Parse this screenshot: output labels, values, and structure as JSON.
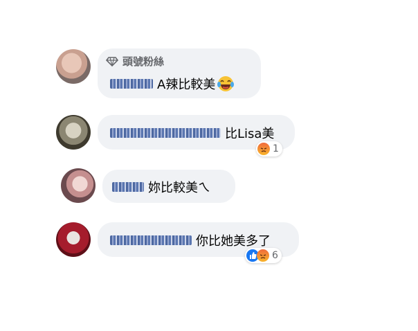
{
  "comments": [
    {
      "badge": "頭號粉絲",
      "name_label": "(blurred name)",
      "text": "A辣比較美",
      "emoji": "laughing-tears-emoji"
    },
    {
      "name_label": "(blurred name)",
      "text": "比Lisa美",
      "reaction_count": "1"
    },
    {
      "name_label": "(blurred name)",
      "text": "妳比較美ㄟ"
    },
    {
      "name_label": "(blurred name)",
      "text": "你比她美多了",
      "reaction_count": "6"
    }
  ],
  "colors": {
    "bubble": "#f0f2f5",
    "name_link": "#385898",
    "like_blue": "#1877f2",
    "angry": "#f06a3c"
  }
}
